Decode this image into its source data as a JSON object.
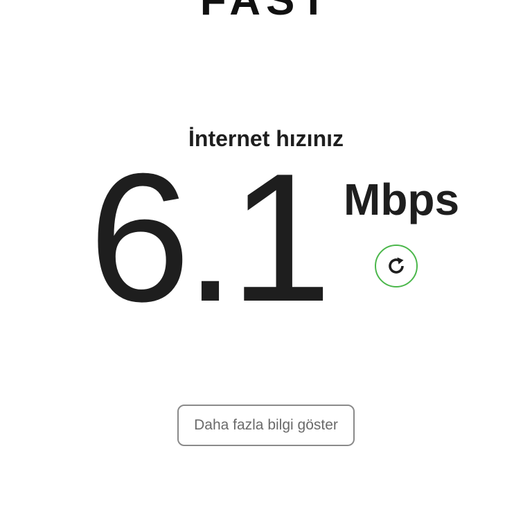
{
  "header": {
    "logo_text": "FAST"
  },
  "result": {
    "label": "İnternet hızınız",
    "value": "6.1",
    "unit": "Mbps"
  },
  "actions": {
    "refresh_icon": "refresh-icon",
    "refresh_color": "#4bb74b",
    "more_info_label": "Daha fazla bilgi göster"
  }
}
